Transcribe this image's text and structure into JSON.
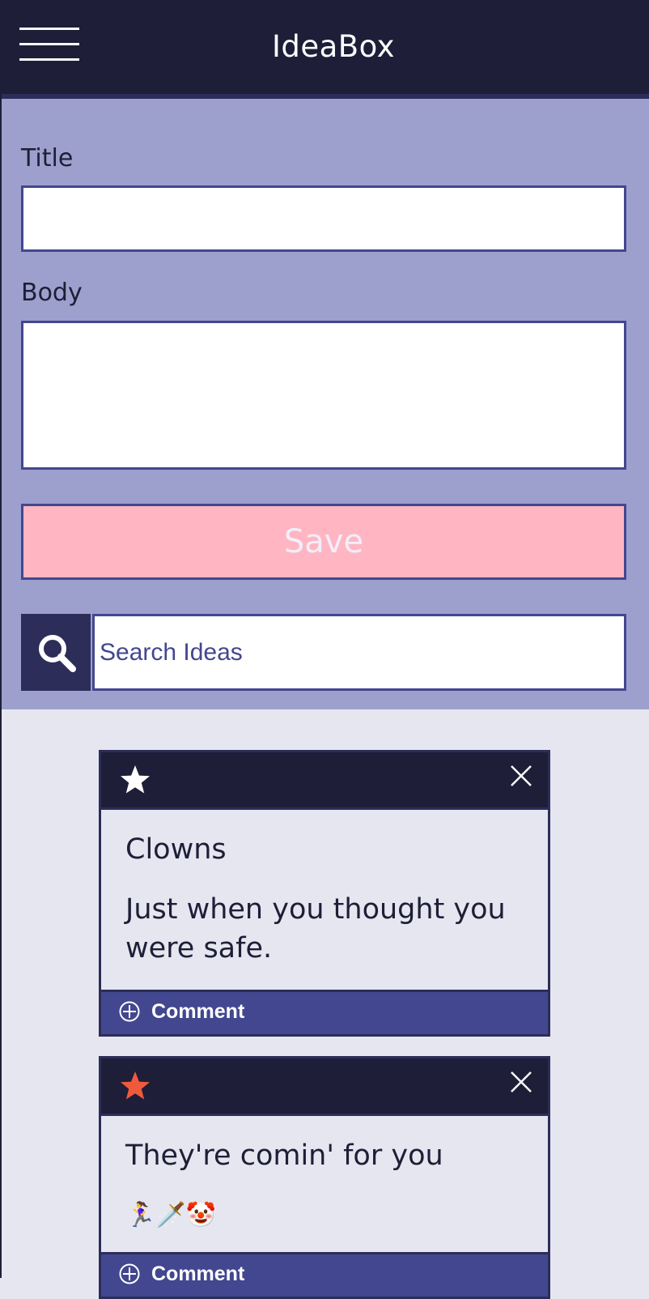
{
  "header": {
    "title": "IdeaBox",
    "menu_icon": "hamburger-menu-icon"
  },
  "form": {
    "title_label": "Title",
    "title_value": "",
    "body_label": "Body",
    "body_value": "",
    "save_label": "Save",
    "search_placeholder": "Search Ideas",
    "search_icon": "search-icon"
  },
  "ideas": [
    {
      "title": "Clowns",
      "body": "Just when you thought you were safe.",
      "starred": false,
      "star_color": "#ffffff",
      "comment_label": "Comment"
    },
    {
      "title": "They're comin' for you",
      "body": "🏃‍♀️🗡️🤡",
      "starred": true,
      "star_color": "#f05a3c",
      "comment_label": "Comment"
    }
  ],
  "colors": {
    "header_bg": "#1e1e38",
    "form_bg": "#9da0cc",
    "page_bg": "#e6e6f0",
    "save_bg": "#ffb6c2",
    "accent": "#43478f",
    "star_active": "#f05a3c"
  }
}
